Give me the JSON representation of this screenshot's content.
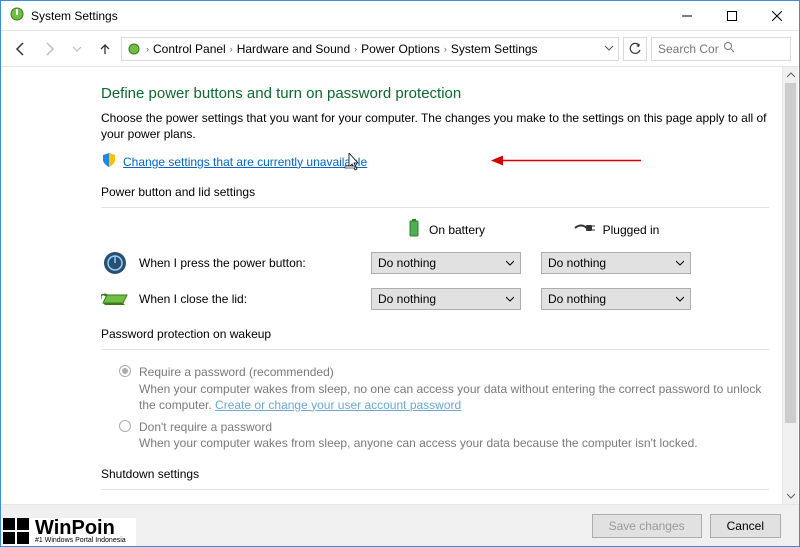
{
  "window": {
    "title": "System Settings"
  },
  "breadcrumb": {
    "items": [
      "Control Panel",
      "Hardware and Sound",
      "Power Options",
      "System Settings"
    ]
  },
  "search": {
    "placeholder": "Search Control Pa..."
  },
  "main": {
    "heading": "Define power buttons and turn on password protection",
    "description": "Choose the power settings that you want for your computer. The changes you make to the settings on this page apply to all of your power plans.",
    "change_link": "Change settings that are currently unavailable",
    "section_buttons": "Power button and lid settings",
    "cols": {
      "battery": "On battery",
      "plugged": "Plugged in"
    },
    "rows": {
      "power_button": {
        "label": "When I press the power button:",
        "battery": "Do nothing",
        "plugged": "Do nothing"
      },
      "close_lid": {
        "label": "When I close the lid:",
        "battery": "Do nothing",
        "plugged": "Do nothing"
      }
    },
    "section_pw": "Password protection on wakeup",
    "pw_require": {
      "title": "Require a password (recommended)",
      "body": "When your computer wakes from sleep, no one can access your data without entering the correct password to unlock the computer. ",
      "link": "Create or change your user account password"
    },
    "pw_dont": {
      "title": "Don't require a password",
      "body": "When your computer wakes from sleep, anyone can access your data because the computer isn't locked."
    },
    "section_shutdown": "Shutdown settings"
  },
  "footer": {
    "save": "Save changes",
    "cancel": "Cancel"
  },
  "watermark": {
    "name": "WinPoin",
    "tag": "#1 Windows Portal Indonesia"
  }
}
